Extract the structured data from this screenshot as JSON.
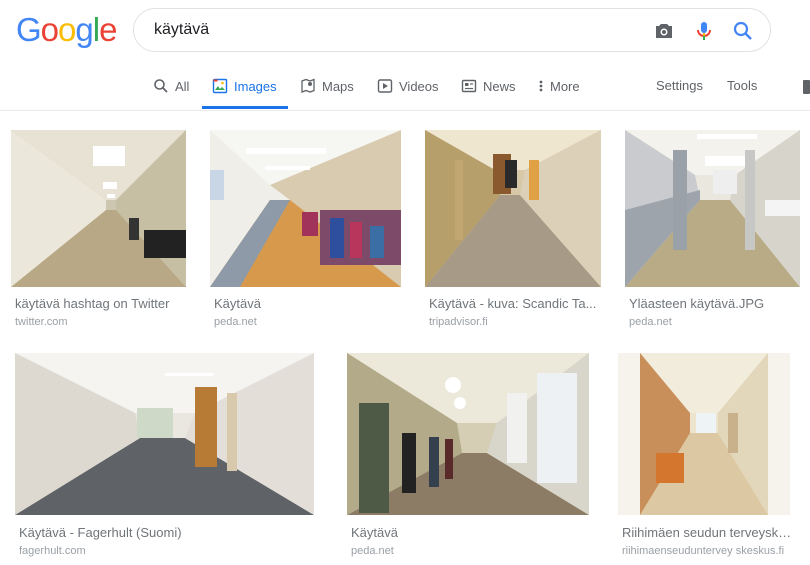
{
  "logo": [
    "G",
    "o",
    "o",
    "g",
    "l",
    "e"
  ],
  "logo_colors": [
    "#4285f4",
    "#ea4335",
    "#fbbc05",
    "#4285f4",
    "#34a853",
    "#ea4335"
  ],
  "search": {
    "query": "käytävä"
  },
  "icons": {
    "camera": "camera-icon",
    "mic": "mic-icon",
    "search": "search-icon"
  },
  "tabs": [
    {
      "label": "All"
    },
    {
      "label": "Images"
    },
    {
      "label": "Maps"
    },
    {
      "label": "Videos"
    },
    {
      "label": "News"
    },
    {
      "label": "More"
    }
  ],
  "tools": {
    "settings": "Settings",
    "tools": "Tools"
  },
  "accent": "#1a73e8",
  "results": [
    {
      "title": "käytävä hashtag on Twitter",
      "source": "twitter.com"
    },
    {
      "title": "Käytävä",
      "source": "peda.net"
    },
    {
      "title": "Käytävä - kuva: Scandic Ta...",
      "source": "tripadvisor.fi"
    },
    {
      "title": "Yläasteen käytävä.JPG",
      "source": "peda.net"
    },
    {
      "title": "Käytävä - Fagerhult (Suomi)",
      "source": "fagerhult.com"
    },
    {
      "title": "Käytävä",
      "source": "peda.net"
    },
    {
      "title": "Riihimäen seudun terveyske...",
      "source": "riihimaenseuduntervey skeskus.fi"
    }
  ]
}
